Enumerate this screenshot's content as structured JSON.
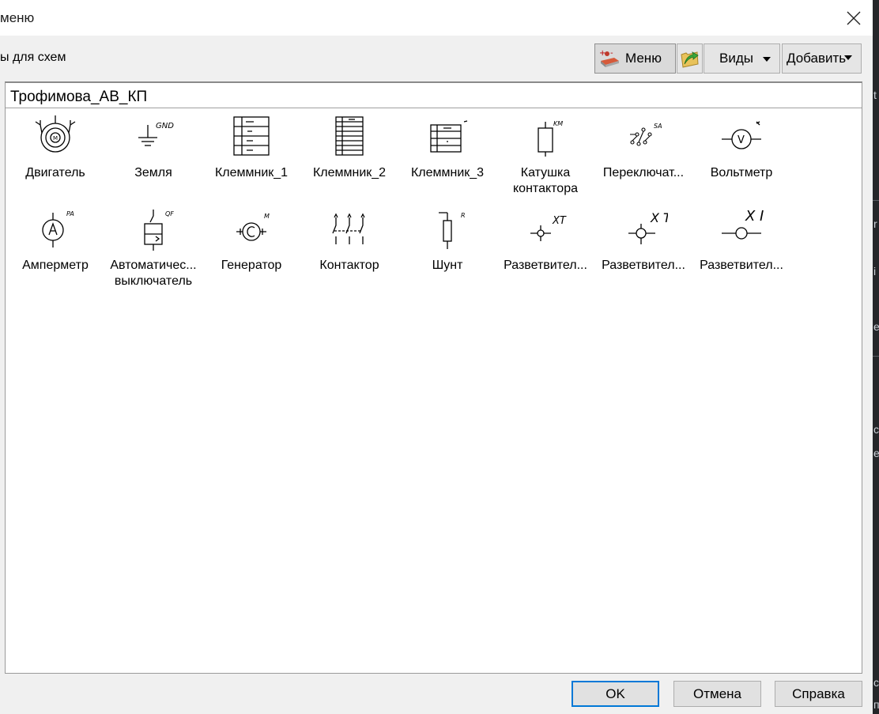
{
  "window": {
    "title": "меню"
  },
  "toolbar": {
    "label": "ы для схем",
    "menu_label": "Меню",
    "views_label": "Виды",
    "add_label": "Добавить"
  },
  "panel": {
    "title": "Трофимова_АВ_КП",
    "items": [
      {
        "label": "Двигатель",
        "label2": "",
        "icon": "motor-icon"
      },
      {
        "label": "Земля",
        "label2": "",
        "icon": "ground-icon",
        "tag": "GND"
      },
      {
        "label": "Клеммник_1",
        "label2": "",
        "icon": "terminal-block-icon"
      },
      {
        "label": "Клеммник_2",
        "label2": "",
        "icon": "terminal-block-icon"
      },
      {
        "label": "Клеммник_3",
        "label2": "",
        "icon": "terminal-block-icon"
      },
      {
        "label": "Катушка",
        "label2": "контактора",
        "icon": "coil-icon",
        "tag": "KM"
      },
      {
        "label": "Переключат...",
        "label2": "",
        "icon": "switch-icon",
        "tag": "SA"
      },
      {
        "label": "Вольтметр",
        "label2": "",
        "icon": "voltmeter-icon",
        "tag": "V"
      },
      {
        "label": "Амперметр",
        "label2": "",
        "icon": "ammeter-icon",
        "tag": "PA"
      },
      {
        "label": "Автоматичес...",
        "label2": "выключатель",
        "icon": "circuit-breaker-icon",
        "tag": "QF"
      },
      {
        "label": "Генератор",
        "label2": "",
        "icon": "generator-icon",
        "tag": "M"
      },
      {
        "label": "Контактор",
        "label2": "",
        "icon": "contactor-icon"
      },
      {
        "label": "Шунт",
        "label2": "",
        "icon": "shunt-icon",
        "tag": "R"
      },
      {
        "label": "Разветвител...",
        "label2": "",
        "icon": "splitter-icon",
        "tag": "XT"
      },
      {
        "label": "Разветвител...",
        "label2": "",
        "icon": "splitter-icon",
        "tag": "X T"
      },
      {
        "label": "Разветвител...",
        "label2": "",
        "icon": "splitter-icon",
        "tag": "X I"
      }
    ]
  },
  "buttons": {
    "ok": "OK",
    "cancel": "Отмена",
    "help": "Справка"
  },
  "background": {
    "chars": [
      "t",
      "r",
      "i",
      "e",
      "c",
      "e",
      "c",
      "п"
    ]
  },
  "colors": {
    "dialog_bg": "#f0f0f0",
    "panel_bg": "#ffffff",
    "ok_border": "#0078d7",
    "app_bg": "#252629"
  }
}
